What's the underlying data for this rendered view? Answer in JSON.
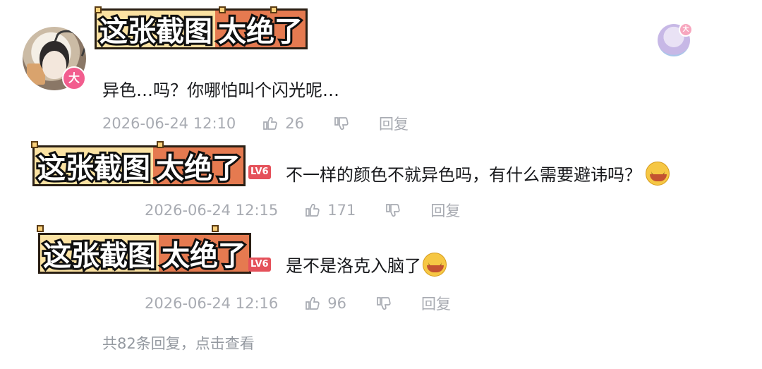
{
  "overlay_label": {
    "part1": "这张截图",
    "part2": "太绝了"
  },
  "main_comment": {
    "avatar_badge": "大",
    "up_badge": "大",
    "text": "异色…吗？你哪怕叫个闪光呢…",
    "time": "2026-06-24 12:10",
    "likes": "26",
    "reply_label": "回复"
  },
  "replies": [
    {
      "level": "LV6",
      "text": "不一样的颜色不就异色吗，有什么需要避讳吗？",
      "emoji": "laughing-crying-emoji",
      "time": "2026-06-24 12:15",
      "likes": "171",
      "reply_label": "回复"
    },
    {
      "level": "LV6",
      "text": "是不是洛克入脑了",
      "emoji": "laughing-crying-emoji",
      "time": "2026-06-24 12:16",
      "likes": "96",
      "reply_label": "回复"
    }
  ],
  "more_replies": "共82条回复，点击查看",
  "colors": {
    "text": "#18191c",
    "meta": "#a8abb2",
    "level_badge": "#e5515a",
    "tag_left": "#fbe2a2",
    "tag_right": "#e57a50"
  }
}
